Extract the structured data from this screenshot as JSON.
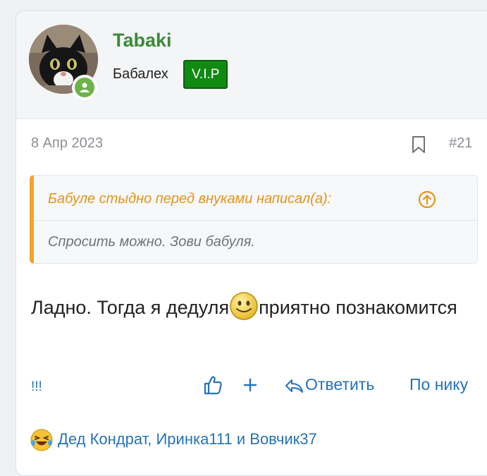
{
  "user": {
    "name": "Tabaki",
    "title": "Бабалех",
    "badge": "V.I.P",
    "online": true
  },
  "post": {
    "date": "8 Апр 2023",
    "number": "#21"
  },
  "quote": {
    "header": "Бабуле стыдно перед внуками написал(а):",
    "body": "Спросить можно. Зови бабуля."
  },
  "message": {
    "part1": "Ладно. Тогда я дедуля",
    "part2": "приятно познакомится"
  },
  "actions": {
    "reactions_label": "!!!",
    "reply": "Ответить",
    "by_name": "По нику"
  },
  "reactions": {
    "users": "Дед Кондрат, Иринка111 и Вовчик37"
  },
  "colors": {
    "username": "#3a8a3a",
    "badge_bg": "#118a14",
    "quote_accent": "#f3a32c",
    "link": "#2672b8"
  }
}
